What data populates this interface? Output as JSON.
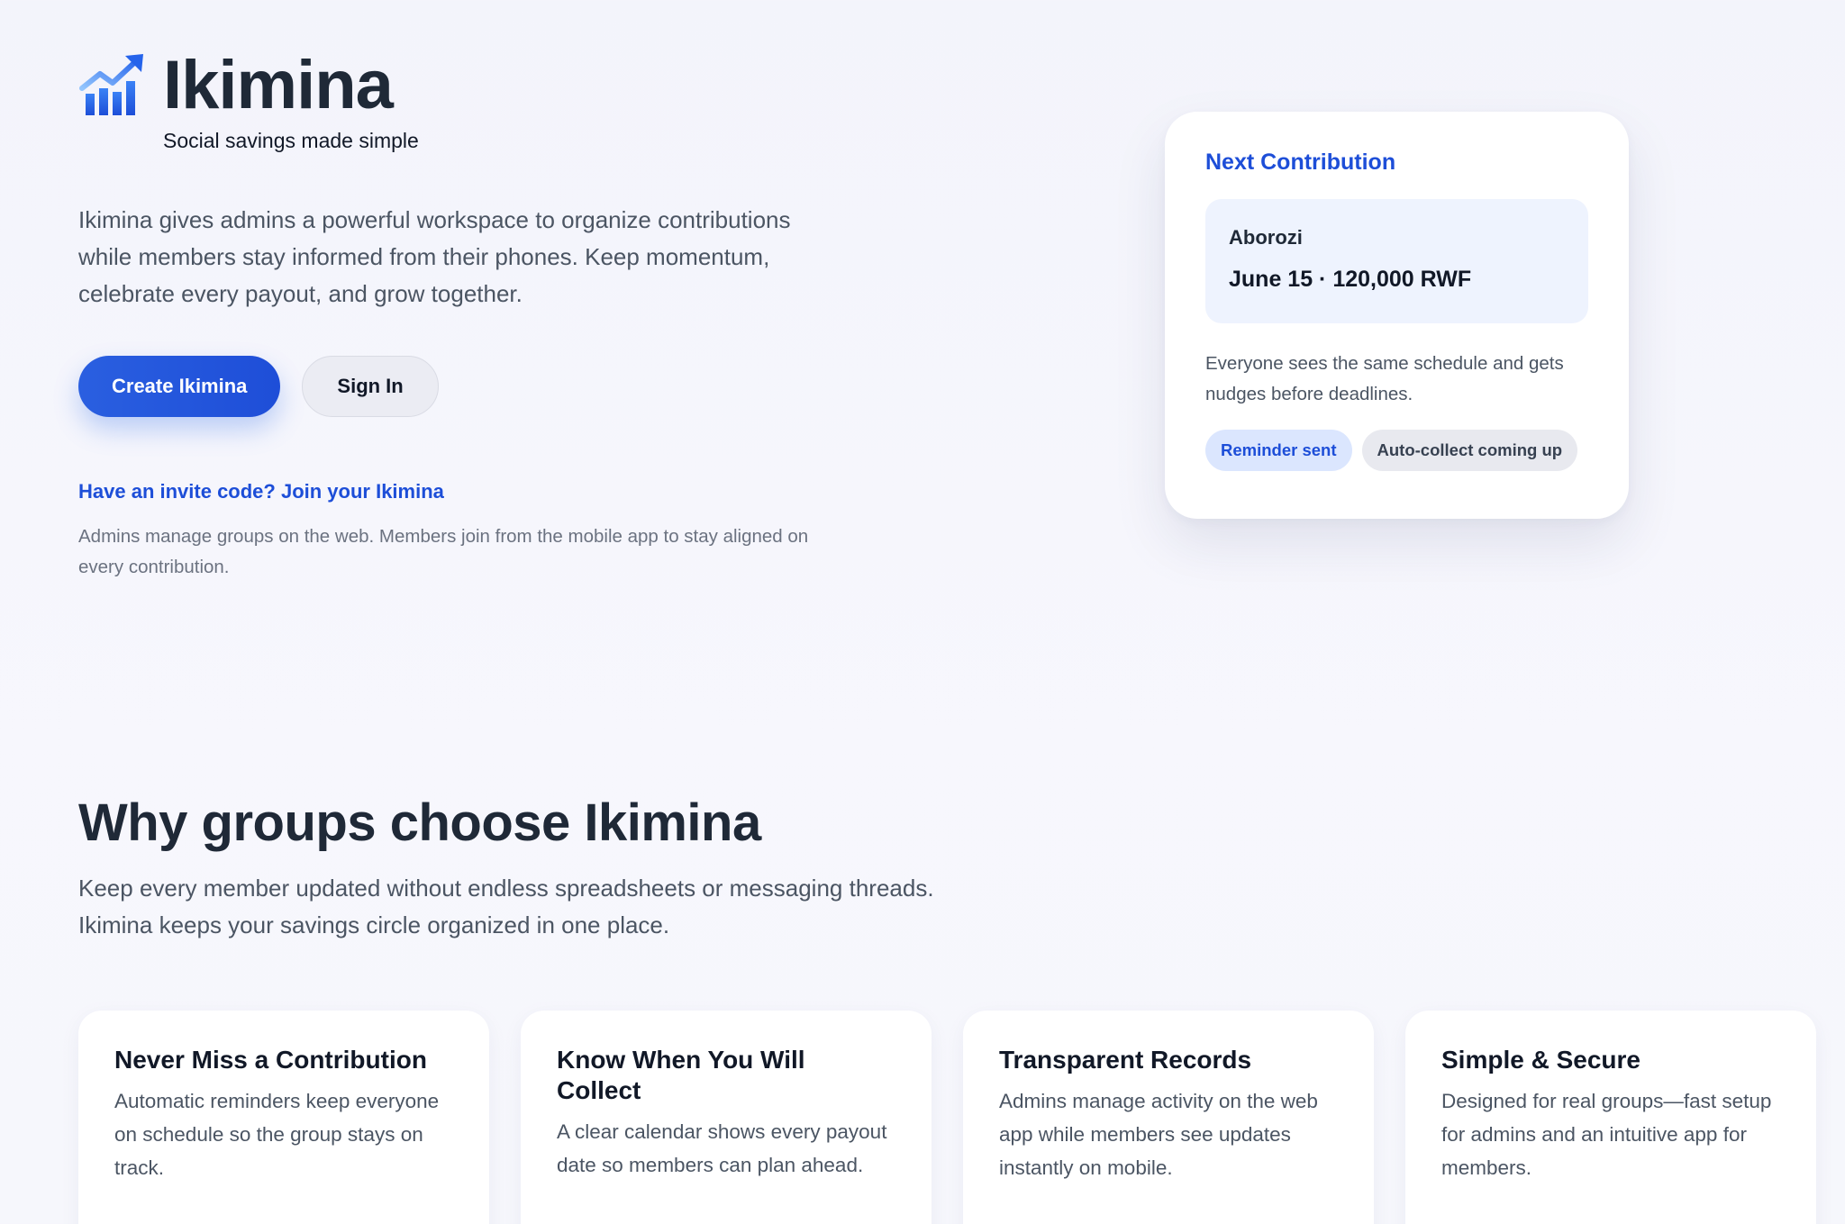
{
  "brand": {
    "name": "Ikimina",
    "tagline": "Social savings made simple",
    "logo_icon": "growth-chart-icon",
    "accent_color": "#1d4ed8"
  },
  "hero": {
    "description": "Ikimina gives admins a powerful workspace to organize contributions while members stay informed from their phones. Keep momentum, celebrate every payout, and grow together.",
    "primary_button": "Create Ikimina",
    "secondary_button": "Sign In",
    "invite_link": "Have an invite code? Join your Ikimina",
    "note": "Admins manage groups on the web. Members join from the mobile app to stay aligned on every contribution."
  },
  "next_contribution": {
    "title": "Next Contribution",
    "group_name": "Aborozi",
    "detail": "June 15 · 120,000 RWF",
    "description": "Everyone sees the same schedule and gets nudges before deadlines.",
    "chips": [
      "Reminder sent",
      "Auto-collect coming up"
    ]
  },
  "why": {
    "title": "Why groups choose Ikimina",
    "description": "Keep every member updated without endless spreadsheets or messaging threads. Ikimina keeps your savings circle organized in one place.",
    "features": [
      {
        "title": "Never Miss a Contribution",
        "description": "Automatic reminders keep everyone on schedule so the group stays on track."
      },
      {
        "title": "Know When You Will Collect",
        "description": "A clear calendar shows every payout date so members can plan ahead."
      },
      {
        "title": "Transparent Records",
        "description": "Admins manage activity on the web app while members see updates instantly on mobile."
      },
      {
        "title": "Simple & Secure",
        "description": "Designed for real groups—fast setup for admins and an intuitive app for members."
      }
    ]
  }
}
